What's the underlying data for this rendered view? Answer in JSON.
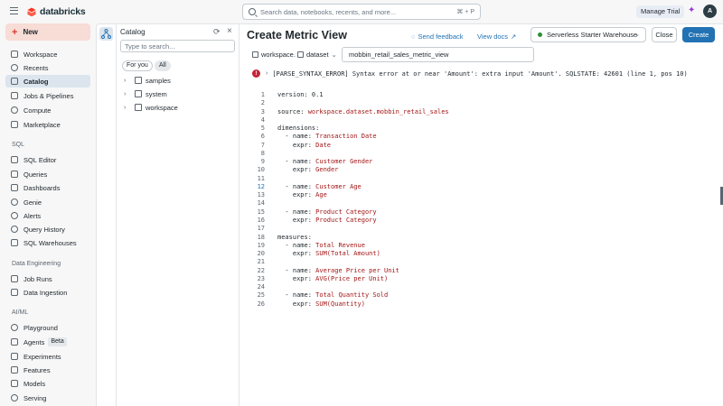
{
  "topbar": {
    "brand": "databricks",
    "search_placeholder": "Search data, notebooks, recents, and more...",
    "search_shortcut": "⌘ + P",
    "trial_label": "Manage Trial",
    "avatar_initial": "A"
  },
  "sidebar": {
    "new_label": "New",
    "items": [
      {
        "label": "Workspace",
        "icon": "folder-icon"
      },
      {
        "label": "Recents",
        "icon": "clock-icon"
      },
      {
        "label": "Catalog",
        "icon": "catalog-icon",
        "active": true
      },
      {
        "label": "Jobs & Pipelines",
        "icon": "workflow-icon"
      },
      {
        "label": "Compute",
        "icon": "cloud-icon"
      },
      {
        "label": "Marketplace",
        "icon": "store-icon"
      }
    ],
    "sql_section": "SQL",
    "sql_items": [
      {
        "label": "SQL Editor"
      },
      {
        "label": "Queries"
      },
      {
        "label": "Dashboards"
      },
      {
        "label": "Genie"
      },
      {
        "label": "Alerts"
      },
      {
        "label": "Query History"
      },
      {
        "label": "SQL Warehouses"
      }
    ],
    "de_section": "Data Engineering",
    "de_items": [
      {
        "label": "Job Runs"
      },
      {
        "label": "Data Ingestion"
      }
    ],
    "ml_section": "AI/ML",
    "ml_items": [
      {
        "label": "Playground"
      },
      {
        "label": "Agents",
        "badge": "Beta"
      },
      {
        "label": "Experiments"
      },
      {
        "label": "Features"
      },
      {
        "label": "Models"
      },
      {
        "label": "Serving"
      }
    ]
  },
  "catalog_panel": {
    "title": "Catalog",
    "search_placeholder": "Type to search...",
    "filters": [
      "For you",
      "All"
    ],
    "tree": [
      "samples",
      "system",
      "workspace"
    ]
  },
  "editor": {
    "title": "Create Metric View",
    "send_feedback": "Send feedback",
    "view_docs": "View docs",
    "warehouse": "Serverless Starter Warehouse",
    "close_label": "Close",
    "create_label": "Create",
    "crumb_catalog": "workspace.",
    "crumb_schema": "dataset",
    "view_name": "mobbin_retail_sales_metric_view",
    "error": "[PARSE_SYNTAX_ERROR] Syntax error at or near 'Amount': extra input 'Amount'. SQLSTATE: 42601 (line 1, pos 10)",
    "code_lines": [
      {
        "k": "version: 0.1",
        "v": ""
      },
      {
        "k": "",
        "v": ""
      },
      {
        "k": "source: ",
        "v": "workspace.dataset.mobbin_retail_sales"
      },
      {
        "k": "",
        "v": ""
      },
      {
        "k": "dimensions:",
        "v": ""
      },
      {
        "k": "  - name: ",
        "v": "Transaction Date"
      },
      {
        "k": "    expr: ",
        "v": "Date"
      },
      {
        "k": "",
        "v": ""
      },
      {
        "k": "  - name: ",
        "v": "Customer Gender"
      },
      {
        "k": "    expr: ",
        "v": "Gender"
      },
      {
        "k": "",
        "v": ""
      },
      {
        "k": "  - name: ",
        "v": "Customer Age"
      },
      {
        "k": "    expr: ",
        "v": "Age"
      },
      {
        "k": "",
        "v": ""
      },
      {
        "k": "  - name: ",
        "v": "Product Category"
      },
      {
        "k": "    expr: ",
        "v": "Product Category"
      },
      {
        "k": "",
        "v": ""
      },
      {
        "k": "measures:",
        "v": ""
      },
      {
        "k": "  - name: ",
        "v": "Total Revenue"
      },
      {
        "k": "    expr: ",
        "v": "SUM(Total Amount)"
      },
      {
        "k": "",
        "v": ""
      },
      {
        "k": "  - name: ",
        "v": "Average Price per Unit"
      },
      {
        "k": "    expr: ",
        "v": "AVG(Price per Unit)"
      },
      {
        "k": "",
        "v": ""
      },
      {
        "k": "  - name: ",
        "v": "Total Quantity Sold"
      },
      {
        "k": "    expr: ",
        "v": "SUM(Quantity)"
      }
    ]
  }
}
